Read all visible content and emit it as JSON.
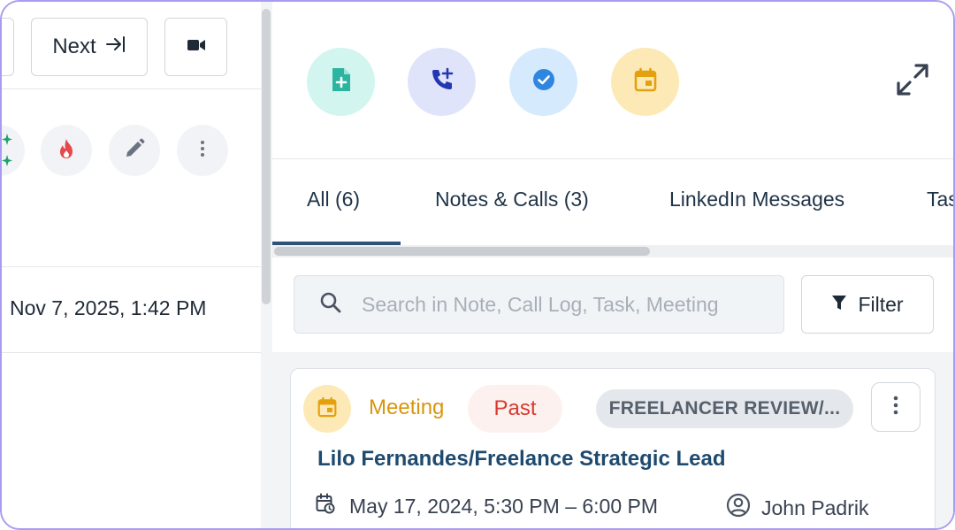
{
  "nav": {
    "next_label": "Next",
    "next_icon": "arrow-right-to-line-icon",
    "video_icon": "video-camera-icon"
  },
  "quick_actions": [
    {
      "name": "ai-sparkle",
      "icon": "sparkle-icon",
      "color": "#22a06b"
    },
    {
      "name": "hot-lead",
      "icon": "fire-icon",
      "color": "#e5484d"
    },
    {
      "name": "edit",
      "icon": "pencil-icon",
      "color": "#6b7280"
    },
    {
      "name": "more",
      "icon": "vertical-dots-icon",
      "color": "#6b7280"
    }
  ],
  "record": {
    "datetime": "Nov 7, 2025, 1:42 PM"
  },
  "activity_actions": [
    {
      "name": "add-note",
      "icon": "note-plus-icon",
      "bg": "#d2f5ef",
      "color": "#2bb5a0"
    },
    {
      "name": "log-call",
      "icon": "phone-plus-icon",
      "bg": "#dfe4fb",
      "color": "#2437b3"
    },
    {
      "name": "add-task",
      "icon": "check-circle-icon",
      "bg": "#d5eafc",
      "color": "#2f86e0"
    },
    {
      "name": "add-meeting",
      "icon": "calendar-icon",
      "bg": "#fde9b5",
      "color": "#e3a10d"
    }
  ],
  "tabs": [
    {
      "label": "All (6)",
      "active": true
    },
    {
      "label": "Notes & Calls (3)",
      "active": false
    },
    {
      "label": "LinkedIn Messages",
      "active": false
    },
    {
      "label": "Tas",
      "active": false
    }
  ],
  "search": {
    "placeholder": "Search in Note, Call Log, Task, Meeting",
    "value": ""
  },
  "filter": {
    "label": "Filter"
  },
  "activity_card": {
    "type_label": "Meeting",
    "status_label": "Past",
    "tag_label": "FREELANCER REVIEW/...",
    "title": "Lilo Fernandes/Freelance Strategic Lead",
    "time_range": "May 17, 2024, 5:30 PM – 6:00 PM",
    "owner": "John Padrik",
    "colors": {
      "type": "#d9950e",
      "status": "#d73a2f",
      "title": "#1e4a6f"
    }
  }
}
